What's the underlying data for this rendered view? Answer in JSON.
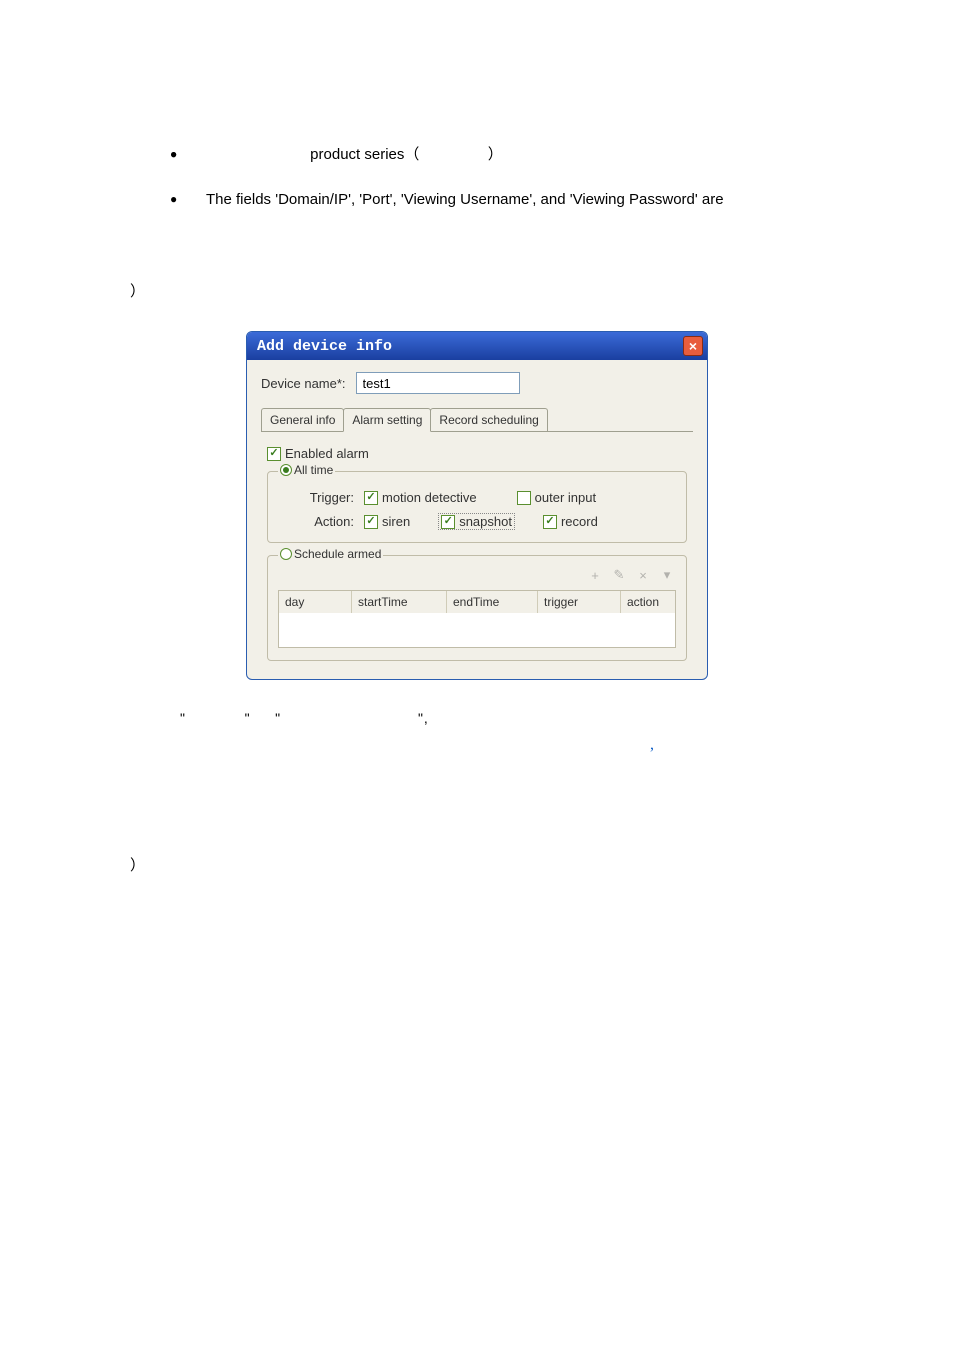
{
  "bullets": {
    "b1": "",
    "b2_prefix": "product series（",
    "b2_suffix": "）",
    "b3": "The fields 'Domain/IP', 'Port', 'Viewing Username', and 'Viewing Password' are"
  },
  "paren1": "）",
  "dialog": {
    "title": "Add device info",
    "close": "×",
    "device_name_label": "Device name*:",
    "device_name_value": "test1",
    "tabs": {
      "general": "General info",
      "alarm": "Alarm setting",
      "record": "Record scheduling"
    },
    "enabled_alarm": "Enabled alarm",
    "all_time": "All time",
    "trigger_label": "Trigger:",
    "motion_detective": "motion detective",
    "outer_input": "outer input",
    "action_label": "Action:",
    "siren": "siren",
    "snapshot": "snapshot",
    "record": "record",
    "schedule_armed": "Schedule armed",
    "toolbar": {
      "add": "+",
      "edit": "✎",
      "del": "×",
      "menu": "▾"
    },
    "cols": {
      "day": "day",
      "startTime": "startTime",
      "endTime": "endTime",
      "trigger": "trigger",
      "action": "action"
    }
  },
  "quote_line": "\"            \"     \"                            \",",
  "comma_mark": ",",
  "paren2": "）"
}
